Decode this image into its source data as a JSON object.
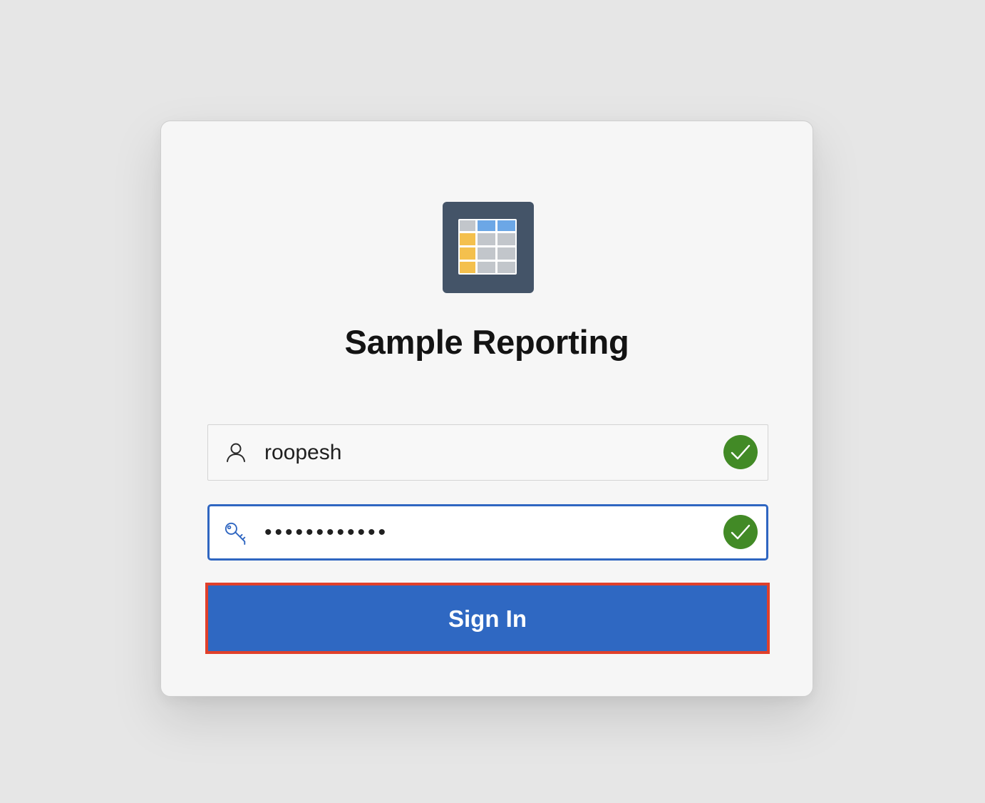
{
  "app": {
    "title": "Sample Reporting",
    "logo_icon": "table-grid-icon"
  },
  "login": {
    "username": {
      "value": "roopesh",
      "icon": "user-icon",
      "status_icon": "check-circle-icon"
    },
    "password": {
      "value": "••••••••••••",
      "icon": "key-icon",
      "status_icon": "check-circle-icon"
    },
    "sign_in_label": "Sign In"
  },
  "colors": {
    "background": "#e6e6e6",
    "card": "#f6f6f6",
    "logo_bg": "#445468",
    "primary": "#2f68c2",
    "focus_border": "#2f66c1",
    "success": "#428a26",
    "highlight_border": "#e0402b"
  }
}
